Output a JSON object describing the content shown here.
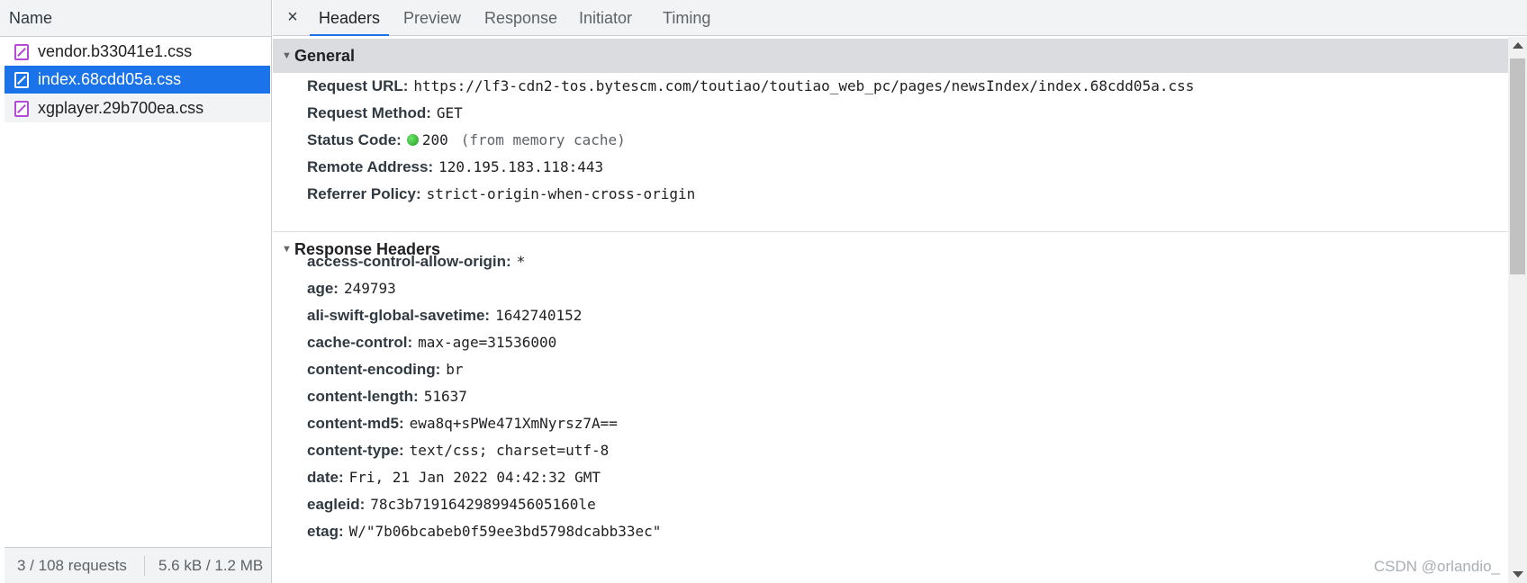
{
  "left": {
    "column_header": "Name",
    "files": [
      {
        "name": "vendor.b33041e1.css",
        "icon": "css-file-icon",
        "selected": false
      },
      {
        "name": "index.68cdd05a.css",
        "icon": "css-file-icon",
        "selected": true
      },
      {
        "name": "xgplayer.29b700ea.css",
        "icon": "css-file-icon",
        "selected": false
      }
    ],
    "status": {
      "requests": "3 / 108 requests",
      "size": "5.6 kB / 1.2 MB"
    }
  },
  "tabs": {
    "close": "×",
    "items": [
      "Headers",
      "Preview",
      "Response",
      "Initiator",
      "Timing"
    ],
    "active": "Headers"
  },
  "general": {
    "title": "General",
    "request_url": {
      "key": "Request URL:",
      "value": "https://lf3-cdn2-tos.bytescm.com/toutiao/toutiao_web_pc/pages/newsIndex/index.68cdd05a.css"
    },
    "request_method": {
      "key": "Request Method:",
      "value": "GET"
    },
    "status_code": {
      "key": "Status Code:",
      "value": "200",
      "note": "(from memory cache)",
      "status_color": "#1e9b1e"
    },
    "remote_address": {
      "key": "Remote Address:",
      "value": "120.195.183.118:443"
    },
    "referrer_policy": {
      "key": "Referrer Policy:",
      "value": "strict-origin-when-cross-origin"
    }
  },
  "response_headers": {
    "title": "Response Headers",
    "items": [
      {
        "key": "access-control-allow-origin:",
        "value": "*"
      },
      {
        "key": "age:",
        "value": "249793"
      },
      {
        "key": "ali-swift-global-savetime:",
        "value": "1642740152"
      },
      {
        "key": "cache-control:",
        "value": "max-age=31536000"
      },
      {
        "key": "content-encoding:",
        "value": "br"
      },
      {
        "key": "content-length:",
        "value": "51637"
      },
      {
        "key": "content-md5:",
        "value": "ewa8q+sPWe471XmNyrsz7A=="
      },
      {
        "key": "content-type:",
        "value": "text/css; charset=utf-8"
      },
      {
        "key": "date:",
        "value": "Fri, 21 Jan 2022 04:42:32 GMT"
      },
      {
        "key": "eagleid:",
        "value": "78c3b7191642989945605160le"
      },
      {
        "key": "etag:",
        "value": "W/\"7b06bcabeb0f59ee3bd5798dcabb33ec\""
      }
    ]
  },
  "watermark": "CSDN @orlandio_",
  "colors": {
    "accent": "#1a73e8",
    "css_icon": "#b44bd6"
  }
}
